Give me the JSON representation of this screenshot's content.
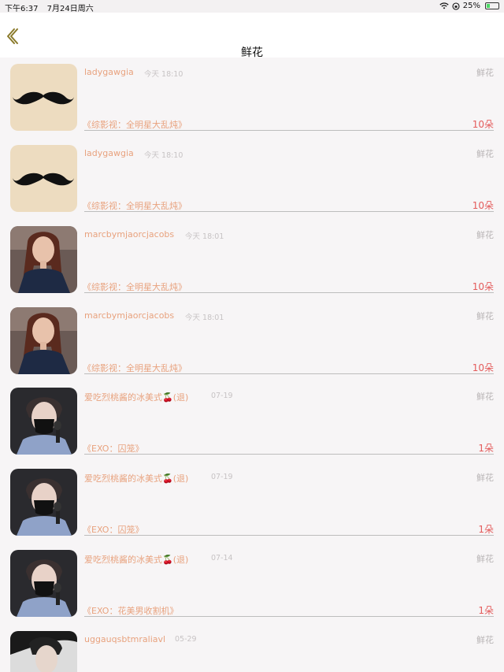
{
  "status_bar": {
    "time": "下午6:37",
    "date": "7月24日周六",
    "battery": "25%"
  },
  "nav": {
    "title": "鲜花"
  },
  "records": [
    {
      "username": "ladygawgia",
      "time": "今天 18:10",
      "type": "鲜花",
      "book": "《综影视：全明星大乱炖》",
      "count": "10朵",
      "avatar": "mustache-avatar"
    },
    {
      "username": "ladygawgia",
      "time": "今天 18:10",
      "type": "鲜花",
      "book": "《综影视：全明星大乱炖》",
      "count": "10朵",
      "avatar": "mustache-avatar"
    },
    {
      "username": "marcbymjaorcjacobs",
      "time": "今天 18:01",
      "type": "鲜花",
      "book": "《综影视：全明星大乱炖》",
      "count": "10朵",
      "avatar": "woman-portrait-avatar"
    },
    {
      "username": "marcbymjaorcjacobs",
      "time": "今天 18:01",
      "type": "鲜花",
      "book": "《综影视：全明星大乱炖》",
      "count": "10朵",
      "avatar": "woman-portrait-avatar"
    },
    {
      "username": "爱吃烈桃酱的冰美式🍒(退)",
      "time": "07-19",
      "type": "鲜花",
      "book": "《EXO：囚笼》",
      "count": "1朵",
      "avatar": "masked-man-avatar"
    },
    {
      "username": "爱吃烈桃酱的冰美式🍒(退)",
      "time": "07-19",
      "type": "鲜花",
      "book": "《EXO：囚笼》",
      "count": "1朵",
      "avatar": "masked-man-avatar"
    },
    {
      "username": "爱吃烈桃酱的冰美式🍒(退)",
      "time": "07-14",
      "type": "鲜花",
      "book": "《EXO：花美男收割机》",
      "count": "1朵",
      "avatar": "masked-man-avatar"
    },
    {
      "username": "uggauqsbtmraliavl",
      "time": "05-29",
      "type": "鲜花",
      "book": "",
      "count": "",
      "avatar": "man-portrait-avatar"
    }
  ]
}
